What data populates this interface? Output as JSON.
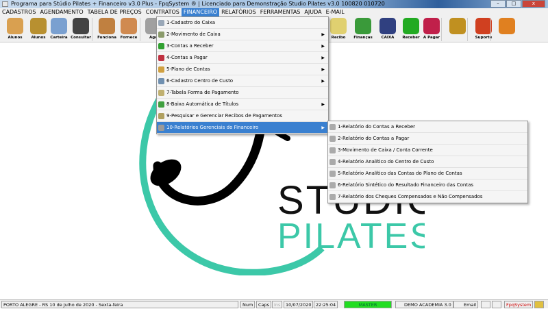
{
  "window": {
    "title": "Programa para Stúdio Pilates + Financeiro v3.0 Plus - FpqSystem ® | Licenciado para  Demonstração Studio Pilates v3.0 100820 010720",
    "min": "–",
    "max": "□",
    "close": "x"
  },
  "menubar": [
    "CADASTROS",
    "AGENDAMENTO",
    "TABELA DE PREÇOS",
    "CONTRATOS",
    "FINANCEIRO",
    "RELATÓRIOS",
    "FERRAMENTAS",
    "AJUDA",
    "E-MAIL"
  ],
  "toolbar": [
    {
      "label": "Alunos",
      "color": "#d9a050"
    },
    {
      "label": "Alunos",
      "color": "#b89030"
    },
    {
      "label": "Carteira",
      "color": "#7aa0d0"
    },
    {
      "label": "Consultar",
      "color": "#444444"
    },
    {
      "label": "Funciona",
      "color": "#c08040"
    },
    {
      "label": "Fornece",
      "color": "#d08a50"
    },
    {
      "label": "Age",
      "color": "#a0a0a0"
    },
    {
      "label": "Recibo",
      "color": "#e0d070"
    },
    {
      "label": "Finanças",
      "color": "#3a9a3a"
    },
    {
      "label": "CAIXA",
      "color": "#304080"
    },
    {
      "label": "Receber",
      "color": "#22aa22"
    },
    {
      "label": "A Pagar",
      "color": "#c0204a"
    },
    {
      "label": "",
      "color": "#c09020"
    },
    {
      "label": "Suporte",
      "color": "#d04020"
    },
    {
      "label": "",
      "color": "#e08020"
    }
  ],
  "menu": [
    {
      "label": "1-Cadastro do Caixa",
      "sub": false,
      "color": "#9aa8b8"
    },
    {
      "label": "2-Movimento de Caixa",
      "sub": true,
      "color": "#8a9a6a"
    },
    {
      "label": "3-Contas a Receber",
      "sub": true,
      "color": "#30a030"
    },
    {
      "label": "4-Contas a Pagar",
      "sub": true,
      "color": "#c03040"
    },
    {
      "label": "5-Plano de Contas",
      "sub": true,
      "color": "#d0a040"
    },
    {
      "label": "6-Cadastro Centro de Custo",
      "sub": true,
      "color": "#7090b0"
    },
    {
      "label": "7-Tabela Forma de Pagamento",
      "sub": false,
      "color": "#c0b070"
    },
    {
      "label": "8-Baixa Automática de Títulos",
      "sub": true,
      "color": "#40a040"
    },
    {
      "label": "9-Pesquisar e Gerenciar Recibos de Pagamentos",
      "sub": false,
      "color": "#b0a060"
    },
    {
      "label": "10-Relatórios Gerenciais do Financeiro",
      "sub": true,
      "color": "#9a9a9a"
    }
  ],
  "submenu": [
    "1-Relatório do Contas a Receber",
    "2-Relatório do Contas a Pagar",
    "3-Movimento de Caixa / Conta Corrente",
    "4-Relatório Analítico do Centro de Custo",
    "5-Relatório Analítico das Contas do Plano de Contas",
    "6-Relatório Sintético do Resultado Financeiro das Contas",
    "7-Relatório dos Cheques Compensados e Não Compensados"
  ],
  "logo": {
    "line1": "STUDIO",
    "line2": "PILATES",
    "teal": "#3cc8a8"
  },
  "status": {
    "location": "PORTO ALEGRE - RS 10 de Julho de 2020 - Sexta-feira",
    "num": "Num",
    "caps": "Caps",
    "ins": "Ins",
    "date": "10/07/2020",
    "time": "22:25:04",
    "user": "MASTER",
    "company": "DEMO ACADEMIA 3.0",
    "email": "Email",
    "brand": "FpqSystem"
  }
}
